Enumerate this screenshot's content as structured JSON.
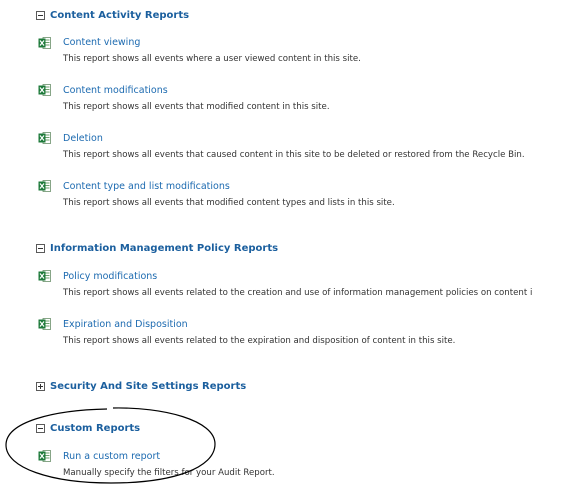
{
  "sections": [
    {
      "title": "Content Activity Reports",
      "expanded": true,
      "reports": [
        {
          "name": "Content viewing",
          "description": "This report shows all events where a user viewed content in this site.",
          "icon": "excel-icon"
        },
        {
          "name": "Content modifications",
          "description": "This report shows all events that modified content in this site.",
          "icon": "excel-icon"
        },
        {
          "name": "Deletion",
          "description": "This report shows all events that caused content in this site to be deleted or restored from the Recycle Bin.",
          "icon": "excel-icon"
        },
        {
          "name": "Content type and list modifications",
          "description": "This report shows all events that modified content types and lists in this site.",
          "icon": "excel-icon"
        }
      ]
    },
    {
      "title": "Information Management Policy Reports",
      "expanded": true,
      "reports": [
        {
          "name": "Policy modifications",
          "description": "This report shows all events related to the creation and use of information management policies on content i",
          "icon": "excel-icon"
        },
        {
          "name": "Expiration and Disposition",
          "description": "This report shows all events related to the expiration and disposition of content in this site.",
          "icon": "excel-icon"
        }
      ]
    },
    {
      "title": "Security And Site Settings Reports",
      "expanded": false,
      "reports": []
    },
    {
      "title": "Custom Reports",
      "expanded": true,
      "reports": [
        {
          "name": "Run a custom report",
          "description": "Manually specify the filters for your Audit Report.",
          "icon": "excel-icon"
        }
      ]
    }
  ],
  "colors": {
    "section_title": "#1b5f9e",
    "link": "#1c6ab0",
    "description": "#333333",
    "excel_green": "#1d7a3a",
    "annotation_oval": "#000000"
  }
}
